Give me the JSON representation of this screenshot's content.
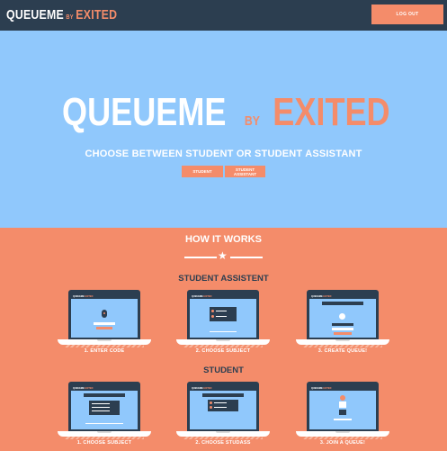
{
  "navbar": {
    "brand_main": "QUEUEME",
    "brand_by": "BY",
    "brand_exited": "EXITED",
    "logout_label": "LOG OUT"
  },
  "hero": {
    "title_main": "QUEUEME",
    "title_by": "BY",
    "title_exited": "EXITED",
    "subtitle": "CHOOSE BETWEEN STUDENT OR STUDENT ASSISTANT",
    "btn_student": "STUDENT",
    "btn_assistant": "STUDENT ASSISTANT"
  },
  "how_it_works": {
    "heading": "HOW IT WORKS",
    "assistant_section": {
      "title": "STUDENT ASSISTENT",
      "steps": [
        {
          "caption": "1. ENTER CODE"
        },
        {
          "caption": "2. CHOOSE SUBJECT"
        },
        {
          "caption": "3. CREATE QUEUE!"
        }
      ]
    },
    "student_section": {
      "title": "STUDENT",
      "steps": [
        {
          "caption": "1. CHOOSE SUBJECT"
        },
        {
          "caption": "2. CHOOSE STUDASS"
        },
        {
          "caption": "3. JOIN A QUEUE!"
        }
      ]
    },
    "mini_brand": "QUEUEME",
    "mini_brand_exited": "EXITED"
  },
  "colors": {
    "navy": "#2c3e50",
    "sky": "#90c8fc",
    "salmon": "#f48c6a",
    "white": "#ffffff"
  }
}
